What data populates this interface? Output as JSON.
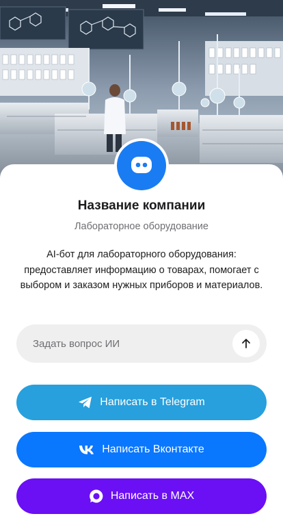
{
  "hero": {
    "image_label": "lab-illustration"
  },
  "company": {
    "name": "Название компании",
    "subtitle": "Лабораторное оборудование",
    "description": "AI-бот для лабораторного оборудования: предоставляет информацию о товарах, помогает с выбором и заказом нужных приборов и материалов."
  },
  "ask": {
    "placeholder": "Задать вопрос ИИ",
    "value": "",
    "send_icon": "arrow-up-icon"
  },
  "buttons": {
    "telegram": {
      "label": "Написать в Telegram",
      "icon": "telegram-icon",
      "color": "#27a0dd"
    },
    "vk": {
      "label": "Написать Вконтакте",
      "icon": "vk-icon",
      "color": "#0a77ff"
    },
    "max": {
      "label": "Написать в MAX",
      "icon": "max-icon",
      "color": "#6b0ff5"
    }
  },
  "colors": {
    "avatar": "#1a7cf2",
    "input_bg": "#efefef"
  }
}
